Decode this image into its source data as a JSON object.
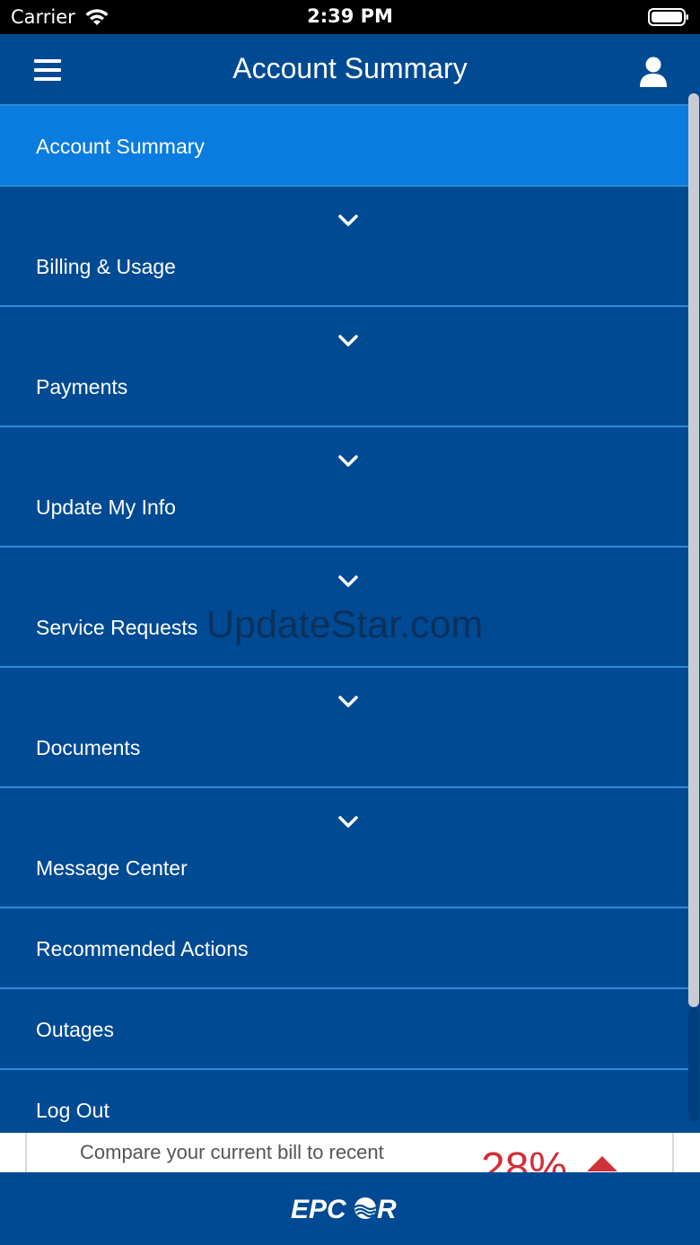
{
  "status_bar": {
    "carrier": "Carrier",
    "time": "2:39 PM"
  },
  "header": {
    "title": "Account Summary"
  },
  "menu": {
    "items": [
      {
        "label": "Account Summary",
        "active": true
      },
      {
        "label": "Billing & Usage",
        "expandable": true
      },
      {
        "label": "Payments",
        "expandable": true
      },
      {
        "label": "Update My Info",
        "expandable": true
      },
      {
        "label": "Service Requests",
        "expandable": true
      },
      {
        "label": "Documents",
        "expandable": true
      },
      {
        "label": "Message Center",
        "expandable": true
      },
      {
        "label": "Recommended Actions"
      },
      {
        "label": "Outages"
      },
      {
        "label": "Log Out"
      }
    ]
  },
  "watermark": "UpdateStar.com",
  "peek_card": {
    "text": "Compare your current bill to recent",
    "percent": "28%"
  },
  "footer": {
    "logo": "EPCOR"
  },
  "colors": {
    "primary": "#004a93",
    "active": "#0a7ce0",
    "divider": "#2a8cd6",
    "alert": "#d0303a"
  }
}
